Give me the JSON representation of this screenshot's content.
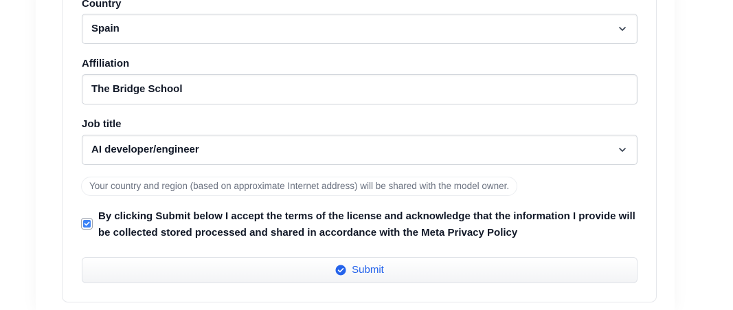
{
  "form": {
    "country": {
      "label": "Country",
      "value": "Spain",
      "icon": "chevron-down-icon"
    },
    "affiliation": {
      "label": "Affiliation",
      "value": "The Bridge School"
    },
    "job_title": {
      "label": "Job title",
      "value": "AI developer/engineer",
      "icon": "chevron-down-icon"
    },
    "region_note": "Your country and region (based on approximate Internet address) will be shared with the model owner.",
    "consent": {
      "checked": true,
      "text": "By clicking Submit below I accept the terms of the license and acknowledge that the information I provide will be collected stored processed and shared in accordance with the Meta Privacy Policy"
    },
    "submit": {
      "label": "Submit",
      "icon": "check-circle-icon"
    }
  },
  "colors": {
    "accent": "#3b82f6",
    "submit_text": "#2563eb",
    "note_text": "#6b7280"
  }
}
